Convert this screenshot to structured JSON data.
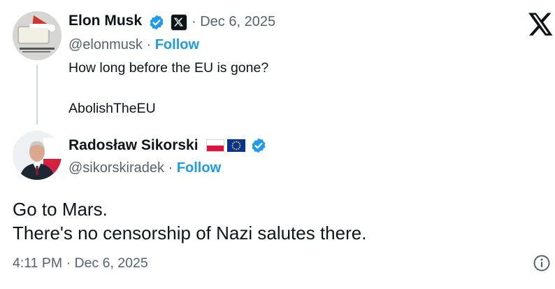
{
  "quoted": {
    "author_name": "Elon Musk",
    "handle": "@elonmusk",
    "date": "· Dec 6, 2025",
    "follow_label": "Follow",
    "separator": "·",
    "text_line1": "How long before the EU is gone?",
    "text_line2": "AbolishTheEU",
    "icons": [
      "verified-badge-icon",
      "x-affiliate-badge-icon"
    ]
  },
  "reply": {
    "author_name": "Radosław Sikorski",
    "handle": "@sikorskiradek",
    "follow_label": "Follow",
    "separator": "·",
    "text_line1": "Go to Mars.",
    "text_line2": "There's no censorship of Nazi salutes there.",
    "icons": [
      "poland-flag-icon",
      "eu-flag-icon",
      "verified-badge-icon"
    ]
  },
  "footer": {
    "timestamp": "4:11 PM · Dec 6, 2025",
    "info_icon": "info-icon"
  },
  "header": {
    "logo_icon": "x-logo-icon"
  },
  "colors": {
    "link": "#1d9bf0",
    "muted": "#536471",
    "verified": "#1d9bf0",
    "thread_line": "#cfd9de"
  }
}
